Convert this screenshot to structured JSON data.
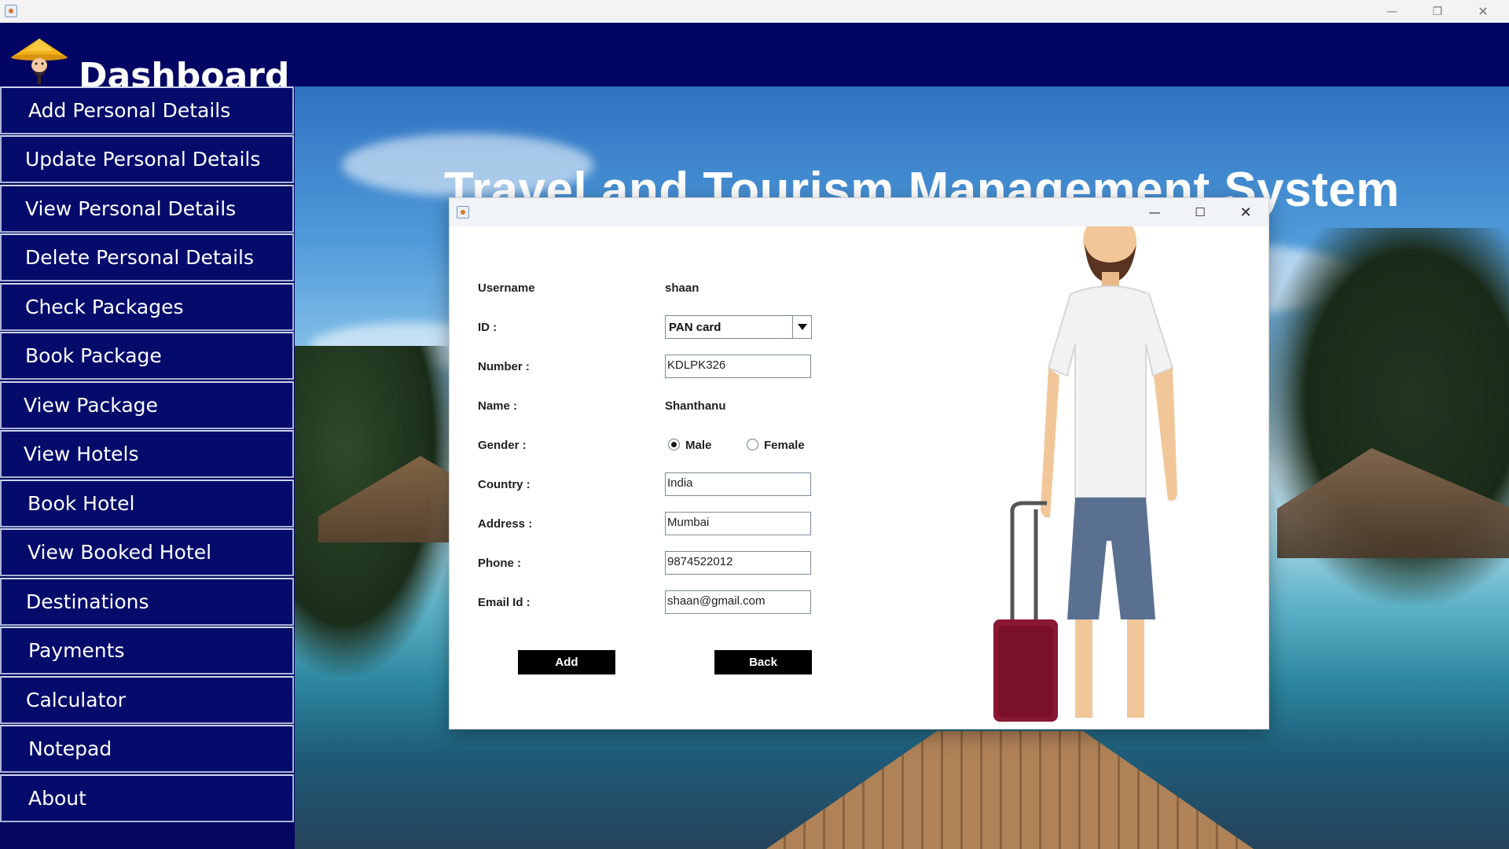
{
  "os_window": {
    "minimize_glyph": "—",
    "maximize_glyph": "❐",
    "close_glyph": "✕"
  },
  "header": {
    "title": "Dashboard",
    "logo_icon": "traveler-hat-logo-icon"
  },
  "sidebar": {
    "items": [
      {
        "label": "Add Personal Details"
      },
      {
        "label": "Update Personal Details"
      },
      {
        "label": "View Personal Details"
      },
      {
        "label": "Delete Personal Details"
      },
      {
        "label": "Check Packages"
      },
      {
        "label": "Book Package"
      },
      {
        "label": "View Package"
      },
      {
        "label": "View Hotels"
      },
      {
        "label": "Book Hotel"
      },
      {
        "label": "View Booked Hotel"
      },
      {
        "label": "Destinations"
      },
      {
        "label": "Payments"
      },
      {
        "label": "Calculator"
      },
      {
        "label": "Notepad"
      },
      {
        "label": "About"
      }
    ]
  },
  "background": {
    "app_title": "Travel and Tourism Management System"
  },
  "dialog": {
    "controls": {
      "minimize_glyph": "—",
      "maximize_glyph": "☐",
      "close_glyph": "✕"
    },
    "form": {
      "username_label": "Username",
      "username_value": "shaan",
      "id_label": "ID :",
      "id_selected": "PAN card",
      "number_label": "Number :",
      "number_value": "KDLPK326",
      "name_label": "Name :",
      "name_value": "Shanthanu",
      "gender_label": "Gender :",
      "gender_options": [
        "Male",
        "Female"
      ],
      "gender_selected": "Male",
      "country_label": "Country :",
      "country_value": "India",
      "address_label": "Address :",
      "address_value": "Mumbai",
      "phone_label": "Phone :",
      "phone_value": "9874522012",
      "email_label": "Email Id :",
      "email_value": "shaan@gmail.com"
    },
    "buttons": {
      "add_label": "Add",
      "back_label": "Back"
    }
  },
  "colors": {
    "sidebar_bg": "#050b6b",
    "header_bg": "#020563",
    "button_bg": "#000000"
  }
}
